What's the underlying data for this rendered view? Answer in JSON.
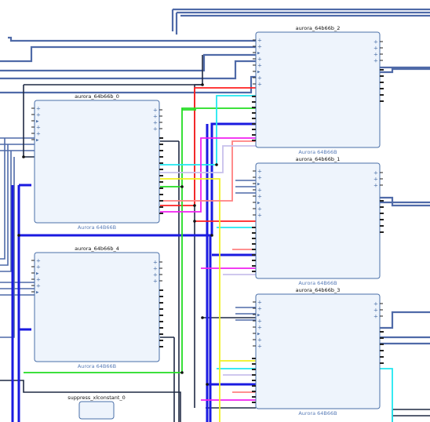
{
  "diagram": {
    "blocks": [
      {
        "id": "b0",
        "title": "aurora_64b66b_0",
        "subtitle": "Aurora 64B66B"
      },
      {
        "id": "b4",
        "title": "aurora_64b66b_4",
        "subtitle": "Aurora 64B66B"
      },
      {
        "id": "b2",
        "title": "aurora_64b66b_2",
        "subtitle": "Aurora 64B66B"
      },
      {
        "id": "b1",
        "title": "aurora_64b66b_1",
        "subtitle": "Aurora 64B66B"
      },
      {
        "id": "b3",
        "title": "aurora_64b66b_3",
        "subtitle": "Aurora 64B66B"
      },
      {
        "id": "xc",
        "title": "suppress_xlconstant_0",
        "subtitle": ""
      }
    ],
    "colors": {
      "block_fill": "#eef4fc",
      "block_stroke": "#4a6fa8",
      "bus": "#4f6aa8",
      "net_dark": "#1f2a44",
      "net_black": "#111111",
      "blue": "#1a1ae0",
      "red": "#ff2020",
      "green": "#22dd22",
      "cyan": "#20e8f0",
      "magenta": "#f020f0",
      "yellow": "#f0f020",
      "salmon": "#ff8080",
      "lavender": "#c8c0ec",
      "pin": "#222222"
    }
  }
}
